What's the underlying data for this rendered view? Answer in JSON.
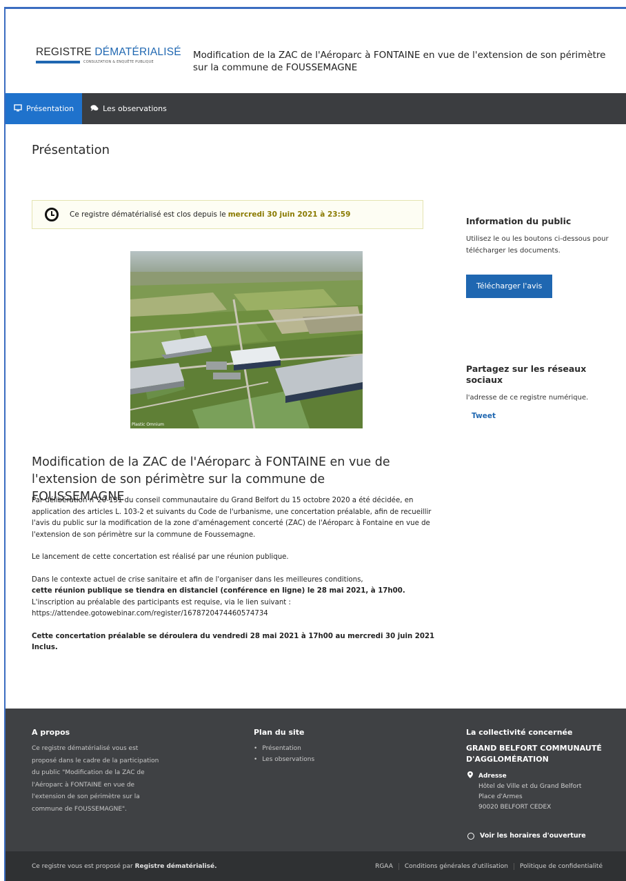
{
  "logo": {
    "part1": "REGISTRE ",
    "part2": "DÉMATÉRIALISÉ",
    "tagline": "CONSULTATION & ENQUÊTE PUBLIQUE"
  },
  "header": {
    "title": "Modification de la ZAC de l'Aéroparc à FONTAINE en vue de l'extension de son périmètre sur la commune de FOUSSEMAGNE"
  },
  "nav": {
    "items": [
      {
        "label": "Présentation",
        "icon": "monitor-icon"
      },
      {
        "label": "Les observations",
        "icon": "comments-icon"
      }
    ]
  },
  "main": {
    "page_title": "Présentation",
    "closed_notice": "Ce registre dématérialisé est clos depuis le",
    "closed_date": "mercredi 30 juin 2021 à 23:59",
    "photo_caption": "Plastic Omnium",
    "article_title": "Modification de la ZAC de l'Aéroparc à FONTAINE en vue de l'extension de son périmètre sur la commune de FOUSSEMAGNE",
    "p1": "Par délibération n°20-131 du conseil communautaire du Grand Belfort du 15 octobre 2020 a été décidée, en application des articles L. 103-2 et suivants du Code de l'urbanisme, une concertation préalable, afin de recueillir l'avis du public sur la modification de la zone d'aménagement concerté (ZAC) de l'Aéroparc à Fontaine en vue de l'extension de son périmètre sur la commune de Foussemagne.",
    "p2": "Le lancement de cette concertation est réalisé par une réunion publique.",
    "p3a": "Dans le contexte actuel de crise sanitaire et afin de l'organiser dans les meilleures conditions,",
    "p3b": "cette réunion publique se tiendra en distanciel (conférence en ligne) le 28 mai 2021, à 17h00.",
    "p3c": "L'inscription au préalable des participants est requise, via le lien suivant :",
    "p3d": "https://attendee.gotowebinar.com/register/1678720474460574734",
    "p4": "Cette concertation préalable se déroulera du vendredi 28 mai 2021 à 17h00 au mercredi 30 juin 2021 Inclus."
  },
  "sidebar": {
    "info_title": "Information du public",
    "info_text": "Utilisez le ou les boutons ci-dessous pour télécharger les documents.",
    "download_label": "Télécharger l'avis",
    "share_title": "Partagez sur les réseaux sociaux",
    "share_text": "l'adresse de ce registre numérique.",
    "tweet_label": "Tweet"
  },
  "footer": {
    "about_title": "A propos",
    "about_text": "Ce registre dématérialisé vous est proposé dans le cadre de la participation du public \"Modification de la ZAC de l'Aéroparc à FONTAINE en vue de l'extension de son périmètre sur la commune de FOUSSEMAGNE\".",
    "plan_title": "Plan du site",
    "plan_items": [
      "Présentation",
      "Les observations"
    ],
    "coll_title": "La collectivité concernée",
    "org_name": "GRAND BELFORT COMMUNAUTÉ D'AGGLOMÉRATION",
    "address_label": "Adresse",
    "address_line1": "Hôtel de Ville et du Grand Belfort",
    "address_line2": "Place d'Armes",
    "address_line3": "90020 BELFORT CEDEX",
    "hours_label": "Voir les horaires d'ouverture"
  },
  "bottombar": {
    "left_text": "Ce registre vous est proposé par",
    "left_brand": "Registre dématérialisé.",
    "links": [
      "RGAA",
      "Conditions générales d'utilisation",
      "Politique de confidentialité"
    ]
  },
  "colors": {
    "brand_blue": "#1f67b1",
    "nav_active": "#1f72cc",
    "nav_bg": "#3b3d40",
    "footer_bg": "#3f4144",
    "date_highlight": "#8a7a00"
  }
}
